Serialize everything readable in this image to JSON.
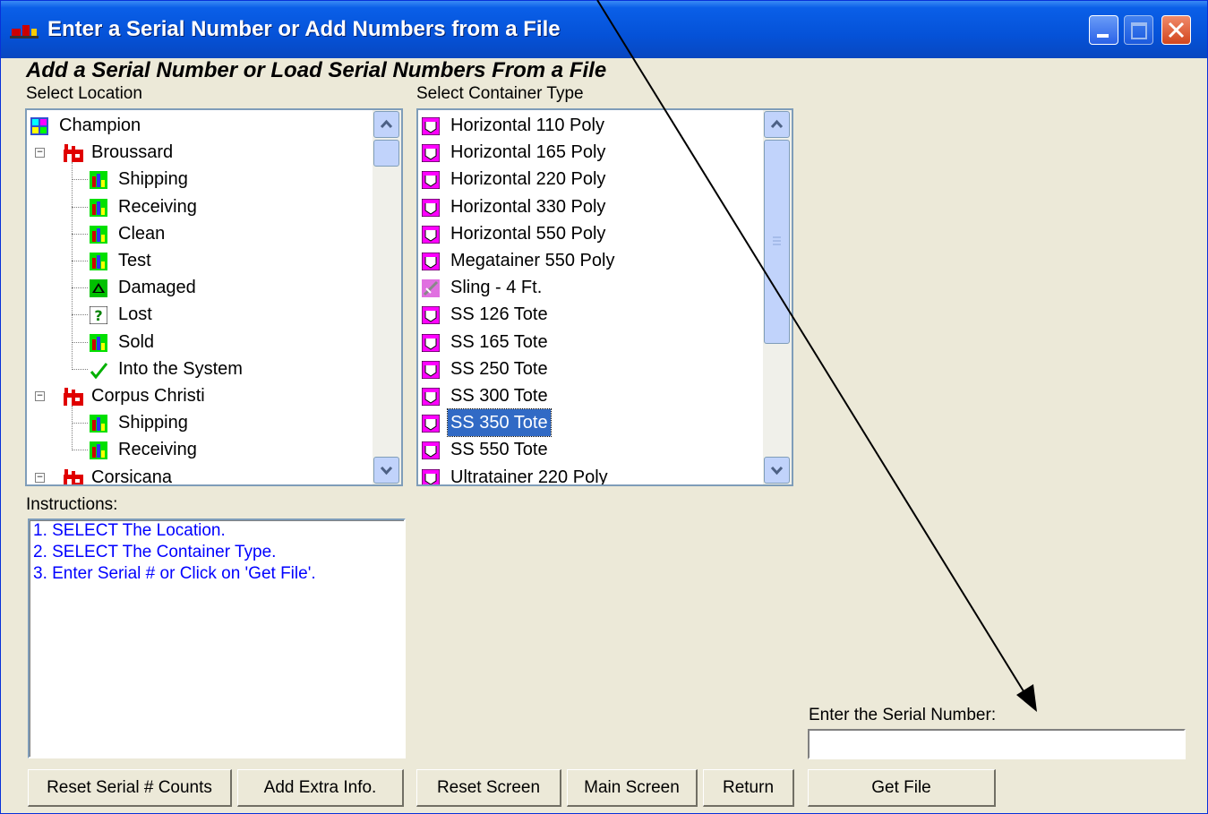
{
  "window": {
    "title": "Enter a Serial Number or Add Numbers from a File"
  },
  "heading": "Add a Serial Number or Load Serial Numbers From a File",
  "location": {
    "label": "Select Location",
    "items": [
      {
        "text": "Champion",
        "icon": "network-icon",
        "level": 0
      },
      {
        "text": "Broussard",
        "icon": "factory-icon",
        "level": 1
      },
      {
        "text": "Shipping",
        "icon": "bar-chart-icon",
        "level": 2
      },
      {
        "text": "Receiving",
        "icon": "bar-chart-icon",
        "level": 2
      },
      {
        "text": "Clean",
        "icon": "bar-chart-icon",
        "level": 2
      },
      {
        "text": "Test",
        "icon": "bar-chart-icon",
        "level": 2
      },
      {
        "text": "Damaged",
        "icon": "damaged-icon",
        "level": 2
      },
      {
        "text": "Lost",
        "icon": "question-icon",
        "level": 2
      },
      {
        "text": "Sold",
        "icon": "bar-chart-icon",
        "level": 2
      },
      {
        "text": "Into the System",
        "icon": "checkmark-icon",
        "level": 2
      },
      {
        "text": "Corpus Christi",
        "icon": "factory-icon",
        "level": 1
      },
      {
        "text": "Shipping",
        "icon": "bar-chart-icon",
        "level": 2
      },
      {
        "text": "Receiving",
        "icon": "bar-chart-icon",
        "level": 2
      },
      {
        "text": "Corsicana",
        "icon": "factory-icon",
        "level": 1
      }
    ]
  },
  "container": {
    "label": "Select Container Type",
    "selected": "SS 350 Tote",
    "items": [
      {
        "text": "Horizontal 110 Poly",
        "icon": "tote-icon"
      },
      {
        "text": "Horizontal 165 Poly",
        "icon": "tote-icon"
      },
      {
        "text": "Horizontal 220 Poly",
        "icon": "tote-icon"
      },
      {
        "text": "Horizontal 330 Poly",
        "icon": "tote-icon"
      },
      {
        "text": "Horizontal 550 Poly",
        "icon": "tote-icon"
      },
      {
        "text": "Megatainer 550 Poly",
        "icon": "tote-icon"
      },
      {
        "text": "Sling - 4 Ft.",
        "icon": "sling-icon"
      },
      {
        "text": "SS 126 Tote",
        "icon": "tote-icon"
      },
      {
        "text": "SS 165 Tote",
        "icon": "tote-icon"
      },
      {
        "text": "SS 250 Tote",
        "icon": "tote-icon"
      },
      {
        "text": "SS 300 Tote",
        "icon": "tote-icon"
      },
      {
        "text": "SS 350 Tote",
        "icon": "tote-icon"
      },
      {
        "text": "SS 550 Tote",
        "icon": "tote-icon"
      },
      {
        "text": "Ultratainer 220 Poly",
        "icon": "tote-icon"
      }
    ]
  },
  "instructions": {
    "label": "Instructions:",
    "lines": [
      "1.  SELECT The Location.",
      "2.  SELECT The Container Type.",
      "3.  Enter Serial # or Click on 'Get File'."
    ]
  },
  "serial": {
    "label": "Enter the Serial Number:",
    "value": ""
  },
  "buttons": {
    "reset_counts": "Reset Serial # Counts",
    "add_extra": "Add Extra Info.",
    "reset_screen": "Reset Screen",
    "main_screen": "Main Screen",
    "return": "Return",
    "get_file": "Get File"
  },
  "colors": {
    "titlebar": "#0552d8",
    "window_bg": "#ece9d8",
    "selection": "#316ac5",
    "instruction_text": "#0000ff",
    "tote_icon": "#ff00ff"
  }
}
